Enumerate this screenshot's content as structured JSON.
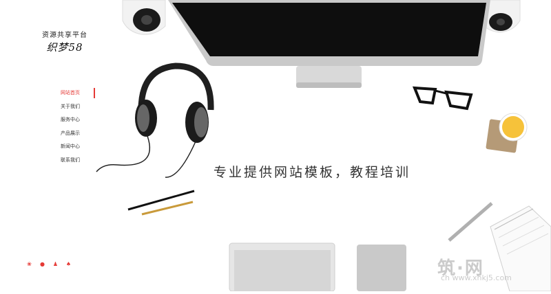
{
  "logo": {
    "line1": "资源共享平台",
    "line2": "织梦58"
  },
  "nav": [
    {
      "label": "网站首页",
      "active": true
    },
    {
      "label": "关于我们",
      "active": false
    },
    {
      "label": "服务中心",
      "active": false
    },
    {
      "label": "产品展示",
      "active": false
    },
    {
      "label": "新闻中心",
      "active": false
    },
    {
      "label": "联系我们",
      "active": false
    }
  ],
  "social": [
    {
      "icon": "weibo-icon",
      "glyph": "❀"
    },
    {
      "icon": "wechat-icon",
      "glyph": "●"
    },
    {
      "icon": "qq-icon",
      "glyph": "♟"
    },
    {
      "icon": "renren-icon",
      "glyph": "♠"
    }
  ],
  "hero": {
    "tagline": "专业提供网站模板，教程培训"
  },
  "watermark": {
    "text": "筑·网",
    "url": "ch   www.xhkj5.com"
  },
  "colors": {
    "accent": "#e53935",
    "text": "#333333",
    "background": "#ffffff"
  }
}
